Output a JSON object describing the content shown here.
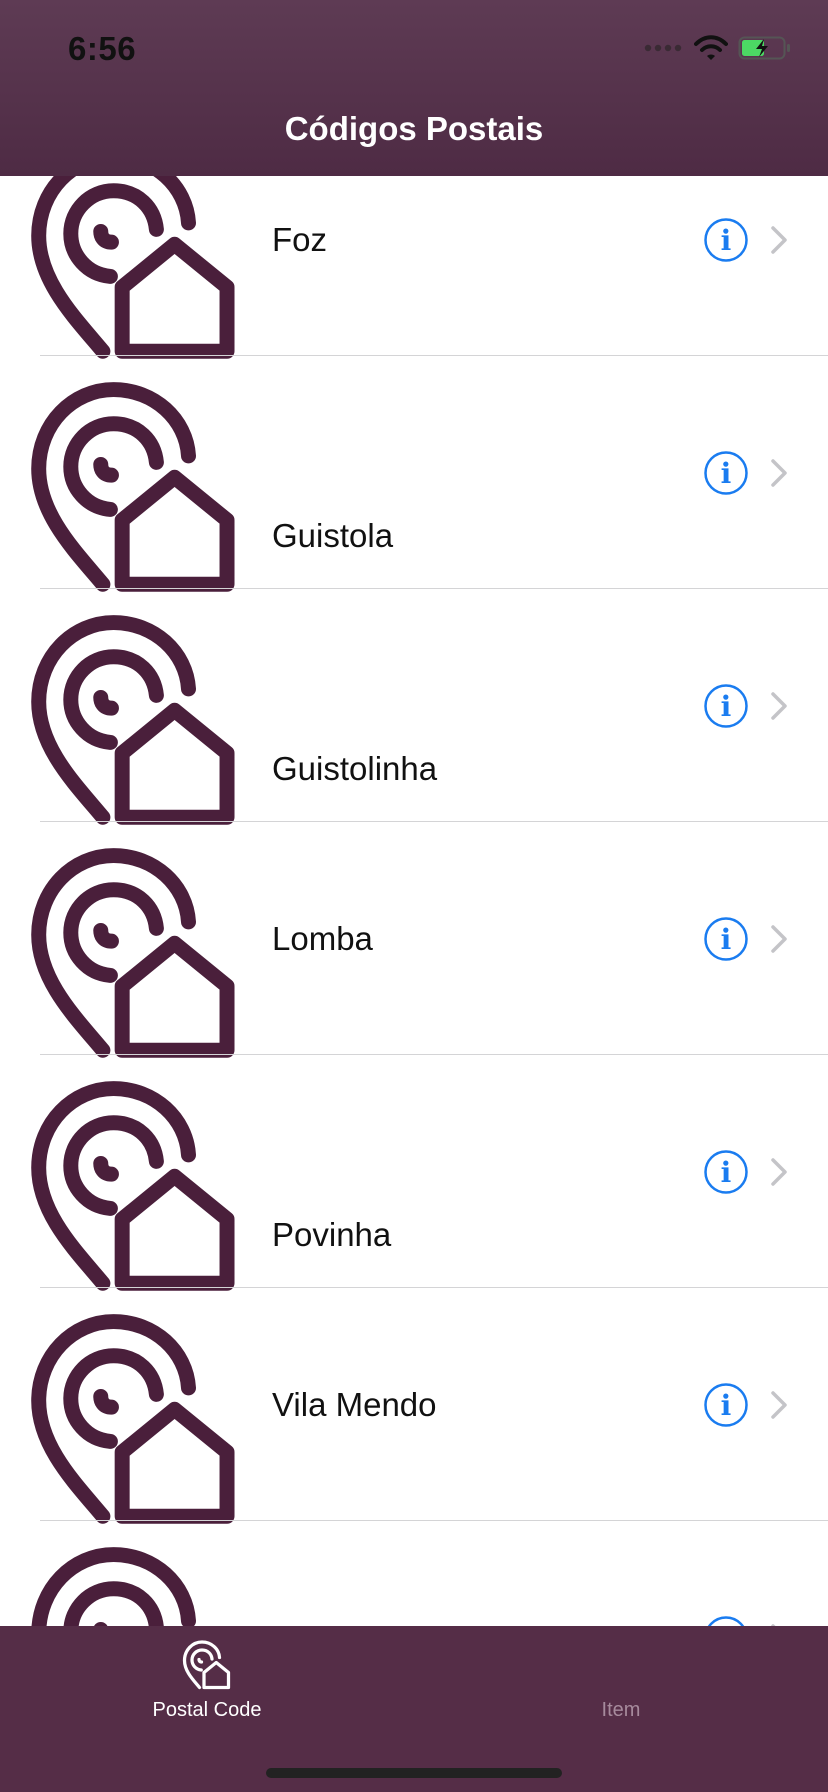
{
  "status_bar": {
    "time": "6:56"
  },
  "nav": {
    "title": "Códigos Postais"
  },
  "list": {
    "items": [
      {
        "label": "Foz"
      },
      {
        "label": "Guistola"
      },
      {
        "label": "Guistolinha"
      },
      {
        "label": "Lomba"
      },
      {
        "label": "Povinha"
      },
      {
        "label": "Vila Mendo"
      },
      {
        "label": ""
      }
    ]
  },
  "tabbar": {
    "tabs": [
      {
        "label": "Postal Code",
        "icon": "postal-code-icon",
        "selected": true
      },
      {
        "label": "Item",
        "icon": "",
        "selected": false
      }
    ]
  },
  "colors": {
    "brand": "#4e2b44",
    "icon_stroke": "#4a1f3b",
    "info_blue": "#1a7cf0",
    "chevron": "#c4c4c8",
    "tab_active": "#ffffff",
    "tab_inactive": "#a68a9c"
  }
}
